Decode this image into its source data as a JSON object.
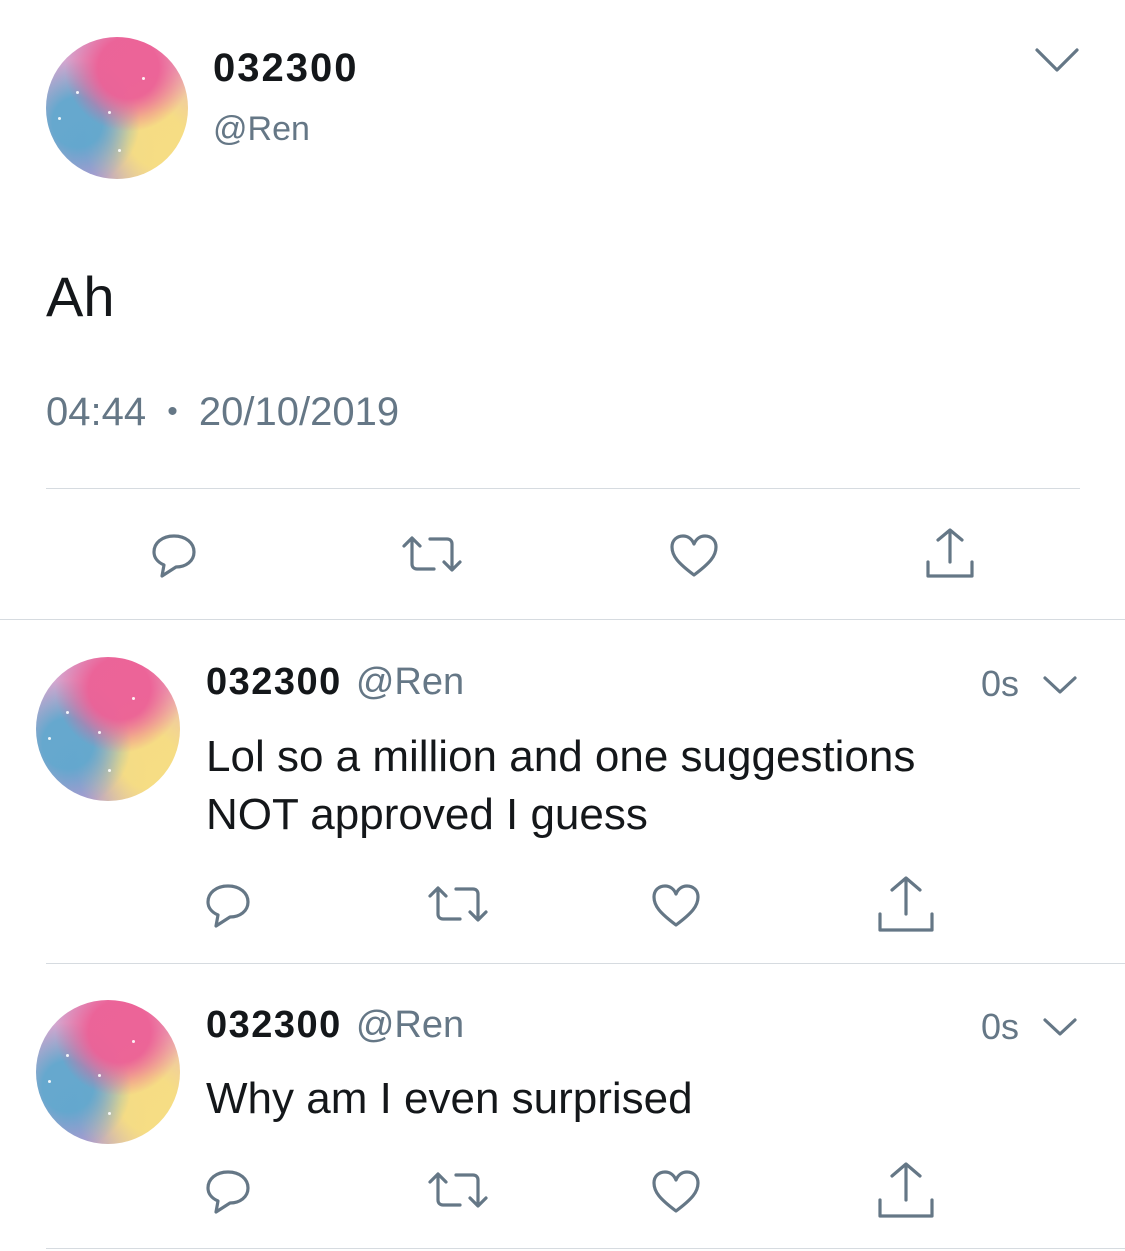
{
  "main_tweet": {
    "display_name": "032300",
    "handle": "@Ren",
    "text": "Ah",
    "time": "04:44",
    "separator": "•",
    "date": "20/10/2019",
    "icons": [
      "chevron-down-icon",
      "reply-icon",
      "retweet-icon",
      "like-icon",
      "share-icon"
    ]
  },
  "replies": [
    {
      "display_name": "032300",
      "handle": "@Ren",
      "time_ago": "0s",
      "line1": "Lol so a million and one suggestions",
      "line2": "NOT approved I guess"
    },
    {
      "display_name": "032300",
      "handle": "@Ren",
      "time_ago": "0s",
      "line1": "Why am I even surprised"
    }
  ],
  "colors": {
    "text": "#14171a",
    "secondary": "#657786",
    "divider": "#d6dbe0",
    "background": "#ffffff"
  }
}
